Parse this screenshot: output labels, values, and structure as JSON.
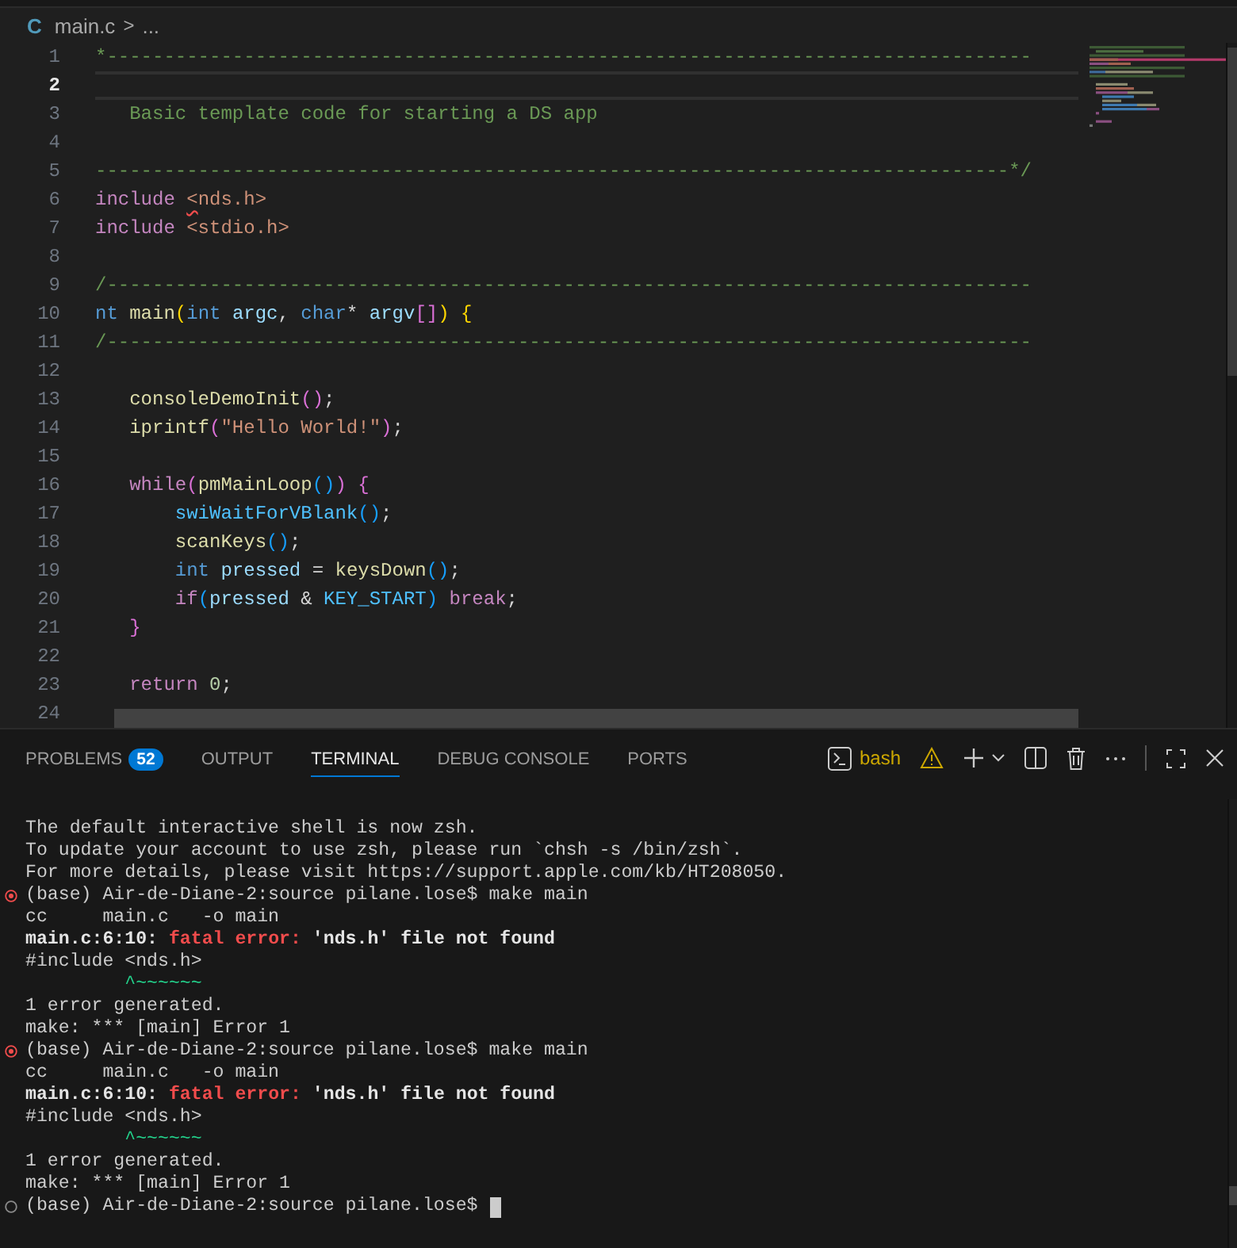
{
  "breadcrumb": {
    "file_icon": "C",
    "file": "main.c",
    "separator": ">",
    "more": "..."
  },
  "editor": {
    "lines": [
      {
        "number": "1",
        "current": false,
        "tokens": [
          {
            "t": "*---------------------------------------------------------------------------------",
            "kind": "comment"
          }
        ]
      },
      {
        "number": "2",
        "current": true
      },
      {
        "number": "3",
        "current": false,
        "tokens": [
          {
            "t": "   Basic template code for starting a DS app",
            "kind": "comment"
          }
        ]
      },
      {
        "number": "4",
        "current": false
      },
      {
        "number": "5",
        "current": false,
        "tokens": [
          {
            "t": "--------------------------------------------------------------------------------*/",
            "kind": "comment"
          }
        ]
      },
      {
        "number": "6",
        "current": false,
        "tokens": [
          {
            "t": "include ",
            "kind": "keyword"
          },
          {
            "t": "<",
            "kind": "path_error"
          },
          {
            "t": "nds.h>",
            "kind": "string"
          }
        ]
      },
      {
        "number": "7",
        "current": false,
        "tokens": [
          {
            "t": "include ",
            "kind": "keyword"
          },
          {
            "t": "<stdio.h>",
            "kind": "string"
          }
        ]
      },
      {
        "number": "8",
        "current": false
      },
      {
        "number": "9",
        "current": false,
        "tokens": [
          {
            "t": "/---------------------------------------------------------------------------------",
            "kind": "comment"
          }
        ]
      },
      {
        "number": "10",
        "current": false,
        "tokens": [
          {
            "t": "nt ",
            "kind": "type"
          },
          {
            "t": "main",
            "kind": "func"
          },
          {
            "t": "(",
            "kind": "b1"
          },
          {
            "t": "int ",
            "kind": "type"
          },
          {
            "t": "argc",
            "kind": "var"
          },
          {
            "t": ", ",
            "kind": "plain"
          },
          {
            "t": "char",
            "kind": "type"
          },
          {
            "t": "* ",
            "kind": "plain"
          },
          {
            "t": "argv",
            "kind": "var"
          },
          {
            "t": "[]",
            "kind": "b2"
          },
          {
            "t": ") ",
            "kind": "b1"
          },
          {
            "t": "{",
            "kind": "b1"
          }
        ]
      },
      {
        "number": "11",
        "current": false,
        "tokens": [
          {
            "t": "/---------------------------------------------------------------------------------",
            "kind": "comment"
          }
        ]
      },
      {
        "number": "12",
        "current": false
      },
      {
        "number": "13",
        "current": false,
        "tokens": [
          {
            "t": "   consoleDemoInit",
            "kind": "func"
          },
          {
            "t": "()",
            "kind": "b2"
          },
          {
            "t": ";",
            "kind": "plain"
          }
        ]
      },
      {
        "number": "14",
        "current": false,
        "tokens": [
          {
            "t": "   iprintf",
            "kind": "func"
          },
          {
            "t": "(",
            "kind": "b2"
          },
          {
            "t": "\"Hello World!\"",
            "kind": "string"
          },
          {
            "t": ")",
            "kind": "b2"
          },
          {
            "t": ";",
            "kind": "plain"
          }
        ]
      },
      {
        "number": "15",
        "current": false
      },
      {
        "number": "16",
        "current": false,
        "tokens": [
          {
            "t": "   while",
            "kind": "keyword"
          },
          {
            "t": "(",
            "kind": "b2"
          },
          {
            "t": "pmMainLoop",
            "kind": "func"
          },
          {
            "t": "()",
            "kind": "b3"
          },
          {
            "t": ") ",
            "kind": "b2"
          },
          {
            "t": "{",
            "kind": "b2"
          }
        ]
      },
      {
        "number": "17",
        "current": false,
        "tokens": [
          {
            "t": "       swiWaitForVBlank",
            "kind": "constant"
          },
          {
            "t": "()",
            "kind": "b3"
          },
          {
            "t": ";",
            "kind": "plain"
          }
        ]
      },
      {
        "number": "18",
        "current": false,
        "tokens": [
          {
            "t": "       scanKeys",
            "kind": "func"
          },
          {
            "t": "()",
            "kind": "b3"
          },
          {
            "t": ";",
            "kind": "plain"
          }
        ]
      },
      {
        "number": "19",
        "current": false,
        "tokens": [
          {
            "t": "       int ",
            "kind": "type"
          },
          {
            "t": "pressed",
            "kind": "var"
          },
          {
            "t": " = ",
            "kind": "plain"
          },
          {
            "t": "keysDown",
            "kind": "func"
          },
          {
            "t": "()",
            "kind": "b3"
          },
          {
            "t": ";",
            "kind": "plain"
          }
        ]
      },
      {
        "number": "20",
        "current": false,
        "tokens": [
          {
            "t": "       if",
            "kind": "keyword"
          },
          {
            "t": "(",
            "kind": "b3"
          },
          {
            "t": "pressed",
            "kind": "var"
          },
          {
            "t": " & ",
            "kind": "plain"
          },
          {
            "t": "KEY_START",
            "kind": "constant"
          },
          {
            "t": ") ",
            "kind": "b3"
          },
          {
            "t": "break",
            "kind": "keyword"
          },
          {
            "t": ";",
            "kind": "plain"
          }
        ]
      },
      {
        "number": "21",
        "current": false,
        "tokens": [
          {
            "t": "   }",
            "kind": "b2"
          }
        ]
      },
      {
        "number": "22",
        "current": false
      },
      {
        "number": "23",
        "current": false,
        "tokens": [
          {
            "t": "   return ",
            "kind": "keyword"
          },
          {
            "t": "0",
            "kind": "number"
          },
          {
            "t": ";",
            "kind": "plain"
          }
        ]
      },
      {
        "number": "24",
        "current": false
      }
    ]
  },
  "panel": {
    "tabs": [
      {
        "label": "PROBLEMS",
        "badge": "52",
        "selected": false
      },
      {
        "label": "OUTPUT",
        "selected": false
      },
      {
        "label": "TERMINAL",
        "selected": true
      },
      {
        "label": "DEBUG CONSOLE",
        "selected": false
      },
      {
        "label": "PORTS",
        "selected": false
      }
    ],
    "shell": "bash"
  },
  "terminal": {
    "lines": [
      {
        "kind": "text",
        "text": "The default interactive shell is now zsh."
      },
      {
        "kind": "text",
        "text": "To update your account to use zsh, please run `chsh -s /bin/zsh`."
      },
      {
        "kind": "text",
        "text": "For more details, please visit https://support.apple.com/kb/HT208050."
      },
      {
        "kind": "prompt",
        "failed": true,
        "text": "(base) Air-de-Diane-2:source pilane.lose$ make main",
        "cursor": false
      },
      {
        "kind": "text",
        "text": "cc     main.c   -o main"
      },
      {
        "kind": "diagnostic",
        "location": "main.c:6:10: ",
        "label": "fatal error:",
        "message": " 'nds.h' file not found"
      },
      {
        "kind": "text",
        "text": "#include <nds.h>"
      },
      {
        "kind": "marker",
        "text": "         ^~~~~~~"
      },
      {
        "kind": "text",
        "text": "1 error generated."
      },
      {
        "kind": "text",
        "text": "make: *** [main] Error 1"
      },
      {
        "kind": "prompt",
        "failed": true,
        "text": "(base) Air-de-Diane-2:source pilane.lose$ make main",
        "cursor": false
      },
      {
        "kind": "text",
        "text": "cc     main.c   -o main"
      },
      {
        "kind": "diagnostic",
        "location": "main.c:6:10: ",
        "label": "fatal error:",
        "message": " 'nds.h' file not found"
      },
      {
        "kind": "text",
        "text": "#include <nds.h>"
      },
      {
        "kind": "marker",
        "text": "         ^~~~~~~"
      },
      {
        "kind": "text",
        "text": "1 error generated."
      },
      {
        "kind": "text",
        "text": "make: *** [main] Error 1"
      },
      {
        "kind": "prompt",
        "failed": false,
        "text": "(base) Air-de-Diane-2:source pilane.lose$ ",
        "cursor": true
      }
    ]
  }
}
